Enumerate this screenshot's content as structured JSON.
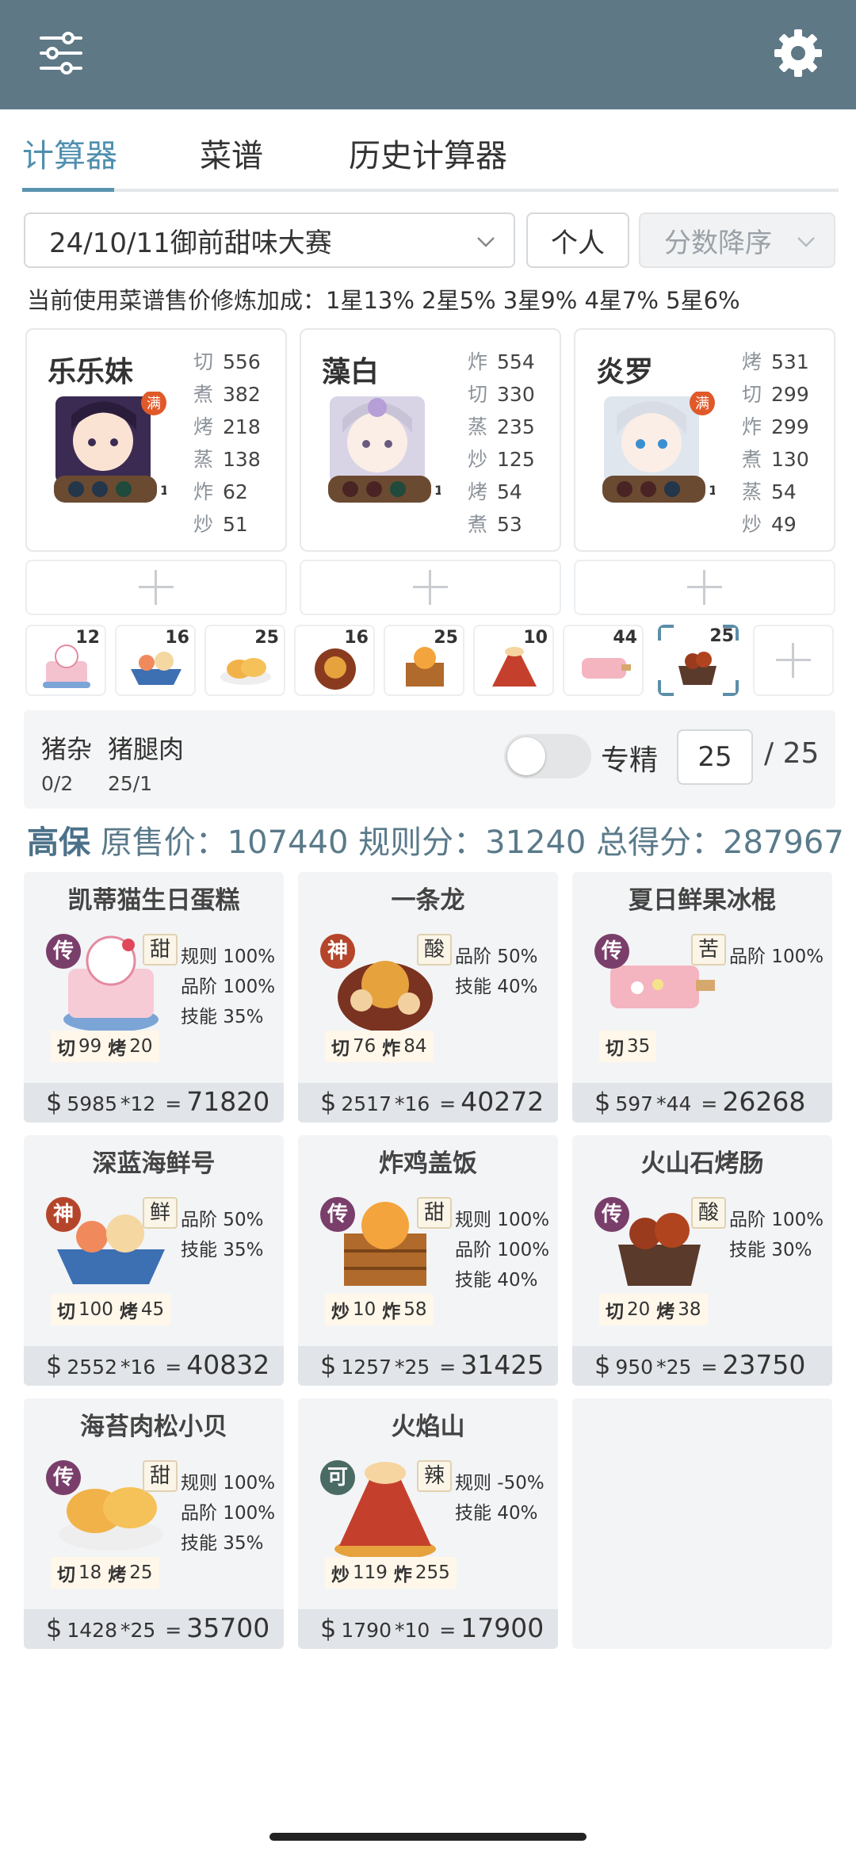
{
  "header": {
    "menu_icon": "sliders-icon",
    "settings_icon": "gear-icon"
  },
  "tabs": [
    {
      "label": "计算器",
      "active": true
    },
    {
      "label": "菜谱",
      "active": false
    },
    {
      "label": "历史计算器",
      "active": false
    }
  ],
  "selectors": {
    "contest": "24/10/11御前甜味大赛",
    "mode": "个人",
    "sort": "分数降序"
  },
  "bonus_text": "当前使用菜谱售价修炼加成：1星13% 2星5% 3星9% 4星7% 5星6%",
  "chefs": [
    {
      "name": "乐乐妹",
      "stats": [
        {
          "k": "切",
          "v": "556"
        },
        {
          "k": "煮",
          "v": "382"
        },
        {
          "k": "烤",
          "v": "218"
        },
        {
          "k": "蒸",
          "v": "138"
        },
        {
          "k": "炸",
          "v": "62"
        },
        {
          "k": "炒",
          "v": "51"
        }
      ]
    },
    {
      "name": "藻白",
      "stats": [
        {
          "k": "炸",
          "v": "554"
        },
        {
          "k": "切",
          "v": "330"
        },
        {
          "k": "蒸",
          "v": "235"
        },
        {
          "k": "炒",
          "v": "125"
        },
        {
          "k": "烤",
          "v": "54"
        },
        {
          "k": "煮",
          "v": "53"
        }
      ]
    },
    {
      "name": "炎罗",
      "stats": [
        {
          "k": "烤",
          "v": "531"
        },
        {
          "k": "切",
          "v": "299"
        },
        {
          "k": "炸",
          "v": "299"
        },
        {
          "k": "煮",
          "v": "130"
        },
        {
          "k": "蒸",
          "v": "54"
        },
        {
          "k": "炒",
          "v": "49"
        }
      ]
    }
  ],
  "chef_badges": {
    "full": "满",
    "level": "1"
  },
  "dish_thumbs": [
    "12",
    "16",
    "25",
    "16",
    "25",
    "10",
    "44",
    "25"
  ],
  "ingredients": [
    {
      "name": "猪杂",
      "qty": "0/2"
    },
    {
      "name": "猪腿肉",
      "qty": "25/1"
    }
  ],
  "specialize": {
    "label": "专精",
    "value": "25",
    "max": "/ 25"
  },
  "score": {
    "grade": "高保",
    "text": "原售价：107440 规则分：31240 总得分：287967"
  },
  "recipes": [
    {
      "title": "凯蒂猫生日蛋糕",
      "rarity": "传",
      "flavor": "甜",
      "mods": [
        "规则 100%",
        "品阶 100%",
        "技能 35%"
      ],
      "skills": [
        {
          "k": "切",
          "v": "99"
        },
        {
          "k": "烤",
          "v": "20"
        }
      ],
      "price": "5985",
      "mult": "*12",
      "total": "71820"
    },
    {
      "title": "一条龙",
      "rarity": "神",
      "flavor": "酸",
      "mods": [
        "品阶 50%",
        "技能 40%"
      ],
      "skills": [
        {
          "k": "切",
          "v": "76"
        },
        {
          "k": "炸",
          "v": "84"
        }
      ],
      "price": "2517",
      "mult": "*16",
      "total": "40272"
    },
    {
      "title": "夏日鲜果冰棍",
      "rarity": "传",
      "flavor": "苦",
      "mods": [
        "品阶 100%"
      ],
      "skills": [
        {
          "k": "切",
          "v": "35"
        }
      ],
      "price": "597",
      "mult": "*44",
      "total": "26268"
    },
    {
      "title": "深蓝海鲜号",
      "rarity": "神",
      "flavor": "鲜",
      "mods": [
        "品阶 50%",
        "技能 35%"
      ],
      "skills": [
        {
          "k": "切",
          "v": "100"
        },
        {
          "k": "烤",
          "v": "45"
        }
      ],
      "price": "2552",
      "mult": "*16",
      "total": "40832"
    },
    {
      "title": "炸鸡盖饭",
      "rarity": "传",
      "flavor": "甜",
      "mods": [
        "规则 100%",
        "品阶 100%",
        "技能 40%"
      ],
      "skills": [
        {
          "k": "炒",
          "v": "10"
        },
        {
          "k": "炸",
          "v": "58"
        }
      ],
      "price": "1257",
      "mult": "*25",
      "total": "31425"
    },
    {
      "title": "火山石烤肠",
      "rarity": "传",
      "flavor": "酸",
      "mods": [
        "品阶 100%",
        "技能 30%"
      ],
      "skills": [
        {
          "k": "切",
          "v": "20"
        },
        {
          "k": "烤",
          "v": "38"
        }
      ],
      "price": "950",
      "mult": "*25",
      "total": "23750"
    },
    {
      "title": "海苔肉松小贝",
      "rarity": "传",
      "flavor": "甜",
      "mods": [
        "规则 100%",
        "品阶 100%",
        "技能 35%"
      ],
      "skills": [
        {
          "k": "切",
          "v": "18"
        },
        {
          "k": "烤",
          "v": "25"
        }
      ],
      "price": "1428",
      "mult": "*25",
      "total": "35700"
    },
    {
      "title": "火焰山",
      "rarity": "可",
      "flavor": "辣",
      "mods": [
        "规则 -50%",
        "技能 40%"
      ],
      "skills": [
        {
          "k": "炒",
          "v": "119"
        },
        {
          "k": "炸",
          "v": "255"
        }
      ],
      "price": "1790",
      "mult": "*10",
      "total": "17900"
    }
  ],
  "colors": {
    "header": "#5e7885",
    "accent": "#4f8fae",
    "rarity_legend": "#7a3e6b",
    "rarity_god": "#b5452a",
    "rarity_common": "#4a6b64"
  }
}
